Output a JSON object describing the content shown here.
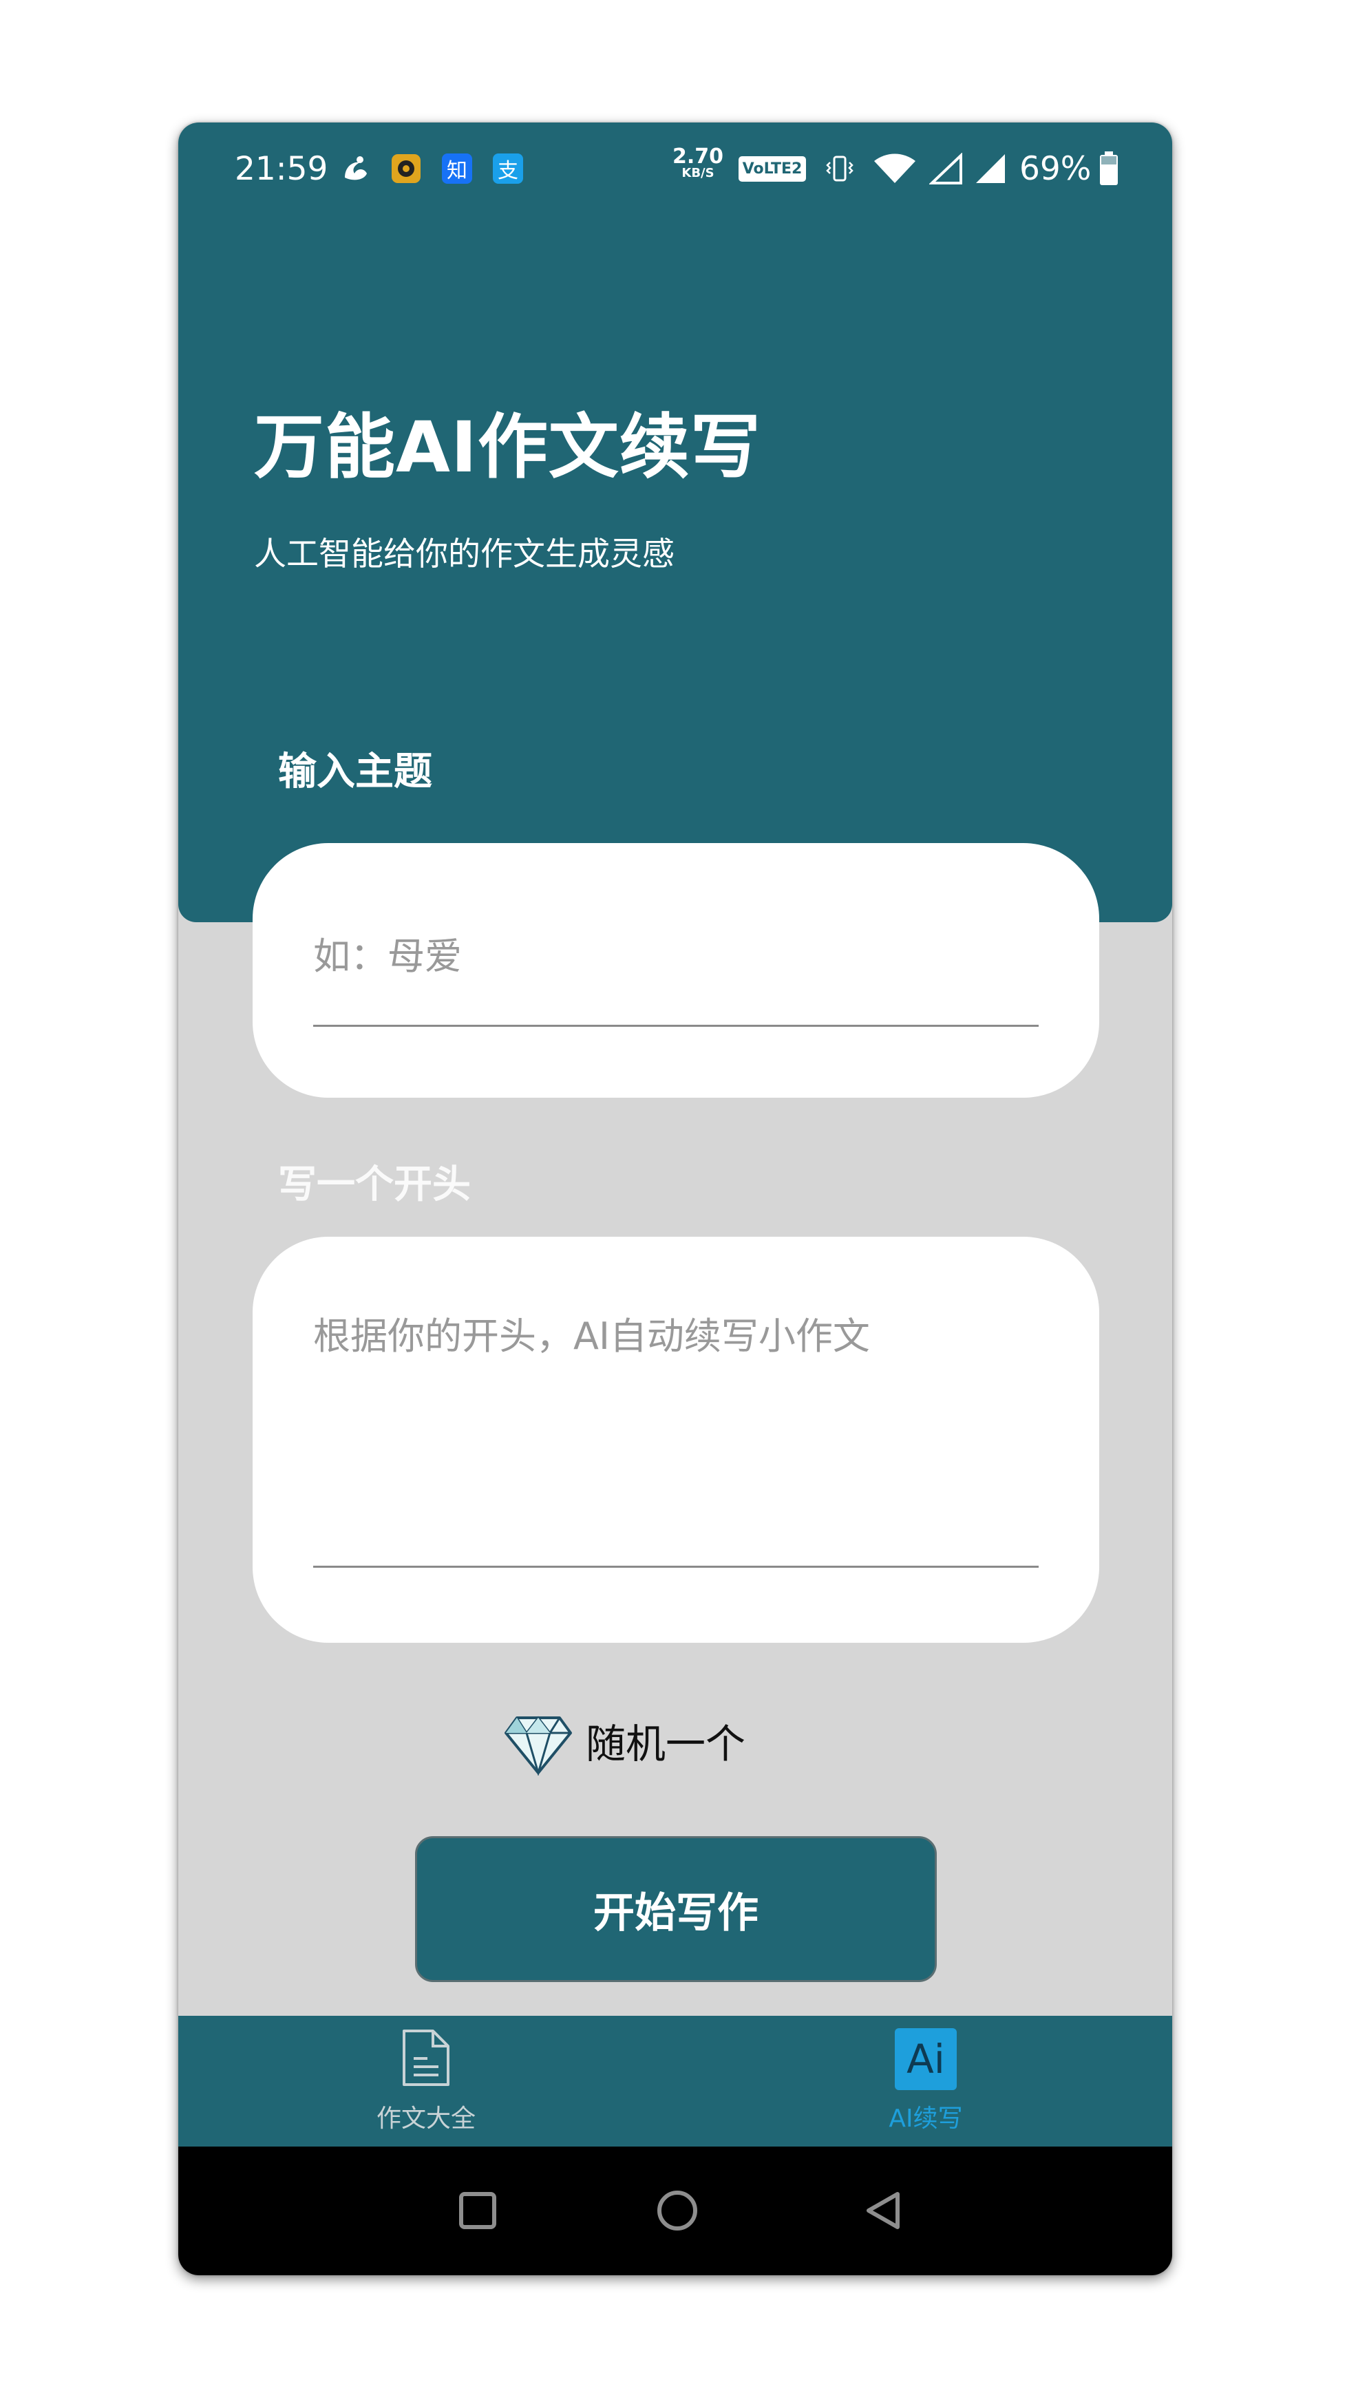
{
  "status_bar": {
    "time": "21:59",
    "net_speed_value": "2.70",
    "net_speed_unit": "KB/S",
    "volte": "VoLTE2",
    "battery": "69%",
    "notification_icons": [
      "uc-browser-icon",
      "music-app-icon",
      "zhihu-icon",
      "alipay-icon"
    ],
    "zhihu_glyph": "知",
    "alipay_glyph": "支"
  },
  "header": {
    "title": "万能AI作文续写",
    "subtitle": "人工智能给你的作文生成灵感"
  },
  "topic": {
    "label": "输入主题",
    "placeholder": "如：母爱",
    "value": ""
  },
  "opening": {
    "label": "写一个开头",
    "placeholder": "根据你的开头，AI自动续写小作文",
    "value": ""
  },
  "random_label": "随机一个",
  "start_button": "开始写作",
  "tabs": [
    {
      "label": "作文大全",
      "icon": "document-icon",
      "active": false
    },
    {
      "label": "AI续写",
      "icon": "ai-icon",
      "icon_text": "Ai",
      "active": true
    }
  ],
  "colors": {
    "primary": "#206674",
    "background": "#d6d6d6",
    "tab_active": "#1e9fdc",
    "tab_inactive": "#c8d3d6"
  }
}
